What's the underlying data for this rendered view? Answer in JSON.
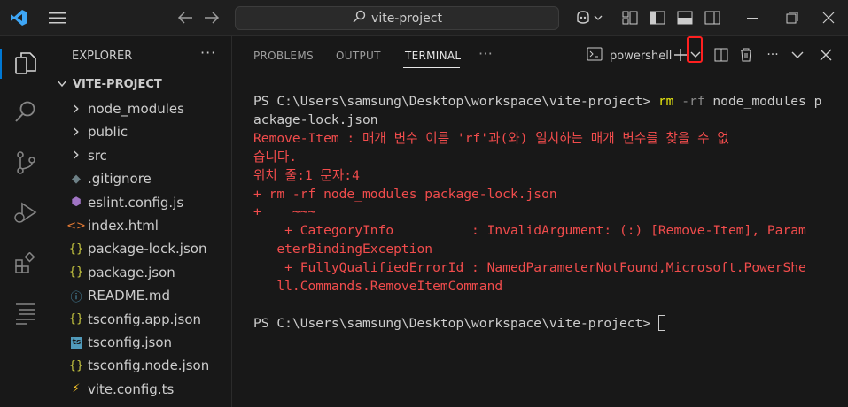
{
  "titlebar": {
    "search_text": "vite-project"
  },
  "sidebar": {
    "header": "EXPLORER",
    "more": "···",
    "project": "VITE-PROJECT",
    "items": [
      {
        "label": "node_modules",
        "icon": "chevron-right-icon",
        "glyph": "›",
        "color": "#cccccc"
      },
      {
        "label": "public",
        "icon": "chevron-right-icon",
        "glyph": "›",
        "color": "#cccccc"
      },
      {
        "label": "src",
        "icon": "chevron-right-icon",
        "glyph": "›",
        "color": "#cccccc"
      },
      {
        "label": ".gitignore",
        "icon": "git-icon",
        "glyph": "◆",
        "color": "#6d8086"
      },
      {
        "label": "eslint.config.js",
        "icon": "eslint-icon",
        "glyph": "⬢",
        "color": "#a074c4"
      },
      {
        "label": "index.html",
        "icon": "html-icon",
        "glyph": "<>",
        "color": "#e37933"
      },
      {
        "label": "package-lock.json",
        "icon": "json-icon",
        "glyph": "{}",
        "color": "#cbcb41"
      },
      {
        "label": "package.json",
        "icon": "json-icon",
        "glyph": "{}",
        "color": "#cbcb41"
      },
      {
        "label": "README.md",
        "icon": "info-icon",
        "glyph": "ⓘ",
        "color": "#519aba"
      },
      {
        "label": "tsconfig.app.json",
        "icon": "json-icon",
        "glyph": "{}",
        "color": "#cbcb41"
      },
      {
        "label": "tsconfig.json",
        "icon": "ts-icon",
        "glyph": "ts",
        "color": "#519aba"
      },
      {
        "label": "tsconfig.node.json",
        "icon": "json-icon",
        "glyph": "{}",
        "color": "#cbcb41"
      },
      {
        "label": "vite.config.ts",
        "icon": "vite-icon",
        "glyph": "⚡",
        "color": "#ffca28"
      }
    ]
  },
  "panel": {
    "tabs": [
      "PROBLEMS",
      "OUTPUT",
      "TERMINAL"
    ],
    "active_tab": "TERMINAL",
    "more": "···",
    "terminal_name": "powershell"
  },
  "terminal": {
    "prompt1": "PS C:\\Users\\samsung\\Desktop\\workspace\\vite-project> ",
    "cmd_rm": "rm",
    "cmd_flag": " -rf",
    "cmd_rest": " node_modules p",
    "cmd_wrap": "ackage-lock.json",
    "err1": "Remove-Item : 매개 변수 이름 'rf'과(와) 일치하는 매개 변수를 찾을 수 없",
    "err2": "습니다.",
    "err3": "위치 줄:1 문자:4",
    "err4": "+ rm -rf node_modules package-lock.json",
    "err5": "+    ~~~",
    "err6": "    + CategoryInfo          : InvalidArgument: (:) [Remove-Item], Param",
    "err7": "   eterBindingException",
    "err8": "    + FullyQualifiedErrorId : NamedParameterNotFound,Microsoft.PowerShe",
    "err9": "   ll.Commands.RemoveItemCommand",
    "prompt2": "PS C:\\Users\\samsung\\Desktop\\workspace\\vite-project> "
  },
  "colors": {
    "accent": "#0078d4",
    "error": "#f14c4c",
    "command": "#e5e510",
    "annotation": "#ff2020"
  }
}
